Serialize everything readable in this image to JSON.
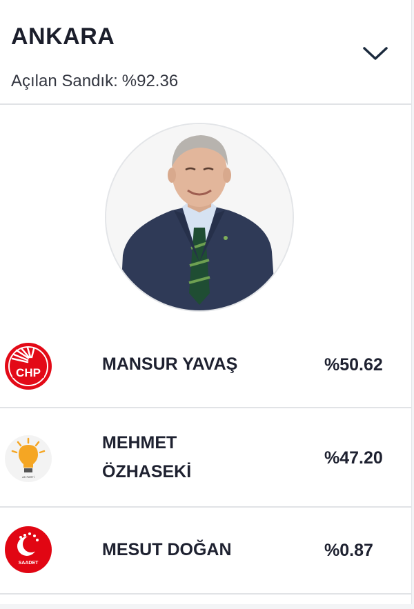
{
  "header": {
    "city": "ANKARA",
    "opened_label": "Açılan Sandık:",
    "opened_value": "%92.36",
    "toggle_icon": "chevron-down-icon"
  },
  "featured_candidate": {
    "photo_icon": "candidate-portrait"
  },
  "candidates": [
    {
      "name_line1": "MANSUR YAVAŞ",
      "name_line2": "",
      "percentage": "%50.62",
      "party_logo": "chp-logo",
      "party_logo_text": "CHP",
      "color": "#e30a17"
    },
    {
      "name_line1": "MEHMET",
      "name_line2": "ÖZHASEKİ",
      "percentage": "%47.20",
      "party_logo": "ak-parti-logo",
      "party_logo_text": "AK PARTİ",
      "color": "#f5a623"
    },
    {
      "name_line1": "MESUT DOĞAN",
      "name_line2": "",
      "percentage": "%0.87",
      "party_logo": "saadet-logo",
      "party_logo_text": "SAADET",
      "color": "#e10613"
    }
  ],
  "colors": {
    "text": "#1e2130",
    "divider": "#e1e3e6",
    "chevron": "#1b2a3d"
  }
}
